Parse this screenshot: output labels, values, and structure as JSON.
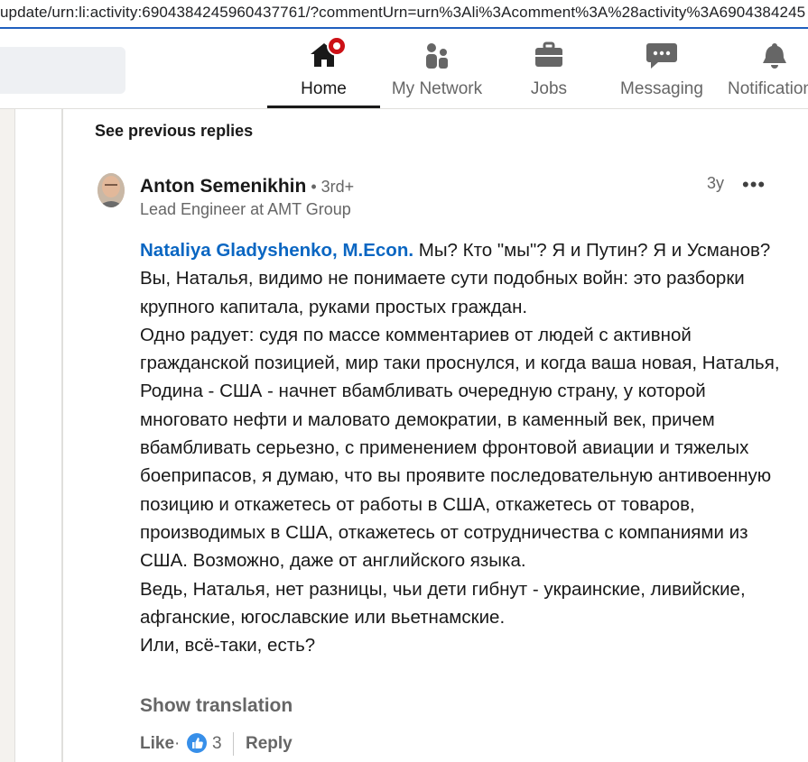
{
  "browser": {
    "url": "update/urn:li:activity:6904384245960437761/?commentUrn=urn%3Ali%3Acomment%3A%28activity%3A6904384245"
  },
  "nav": {
    "items": [
      {
        "label": "Home",
        "icon": "home-icon",
        "active": true
      },
      {
        "label": "My Network",
        "icon": "network-icon"
      },
      {
        "label": "Jobs",
        "icon": "briefcase-icon"
      },
      {
        "label": "Messaging",
        "icon": "messaging-icon"
      },
      {
        "label": "Notifications",
        "icon": "bell-icon"
      }
    ]
  },
  "thread": {
    "see_previous": "See previous replies"
  },
  "comment": {
    "author": "Anton Semenikhin",
    "degree": " • 3rd+",
    "headline": "Lead Engineer at AMT Group",
    "time": "3y",
    "more": "•••",
    "mention": "Nataliya Gladyshenko, M.Econ.",
    "paragraphs": [
      " Мы? Кто \"мы\"? Я и Путин? Я и Усманов? Вы, Наталья, видимо не понимаете сути подобных войн: это разборки крупного капитала, руками простых граждан.",
      "Одно радует: судя по массе комментариев от людей с активной гражданской позицией, мир таки проснулся, и когда ваша новая, Наталья, Родина - США - начнет вбамбливать очередную страну, у которой многовато нефти и маловато демократии, в каменный век, причем вбамбливать серьезно, с применением фронтовой авиации и тяжелых боеприпасов, я думаю, что вы проявите последовательную антивоенную позицию и откажетесь от работы в США, откажетесь от товаров, производимых в США, откажетесь от сотрудничества с компаниями из США. Возможно, даже от английского языка.",
      "Ведь, Наталья, нет разницы, чьи дети гибнут - украинские, ливийские, афганские, югославские или вьетнамские.",
      "Или, всё-таки, есть?"
    ],
    "show_translation": "Show translation",
    "like_label": "Like",
    "dot": "·",
    "like_count": "3",
    "reply_label": "Reply"
  },
  "colors": {
    "accent": "#0a66c2",
    "notification": "#cc1016",
    "muted_text": "#666666"
  }
}
